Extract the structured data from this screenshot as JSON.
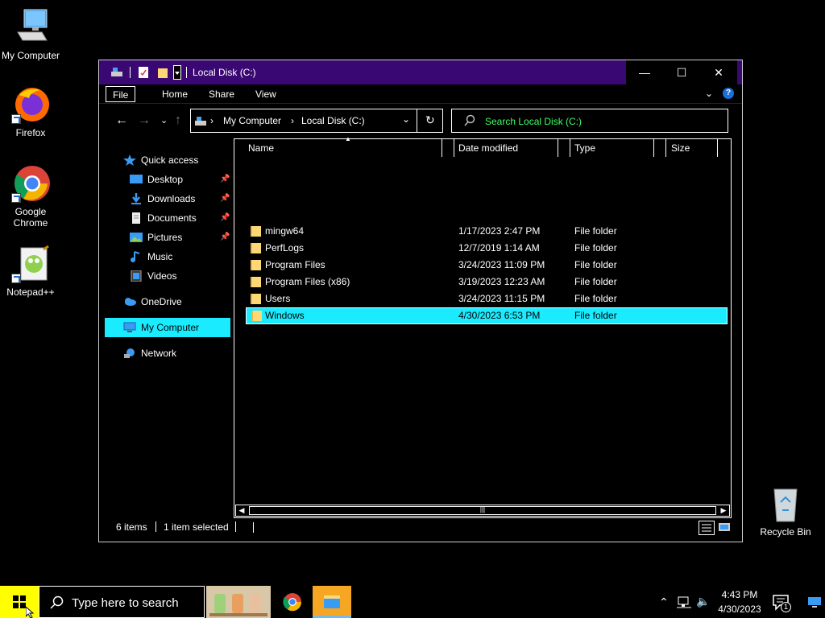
{
  "desktop": {
    "icons": [
      {
        "label": "My Computer"
      },
      {
        "label": "Firefox"
      },
      {
        "label": "Google Chrome"
      },
      {
        "label": "Notepad++"
      },
      {
        "label": "Recycle Bin"
      }
    ]
  },
  "window": {
    "title": "Local Disk (C:)",
    "controls": {
      "minimize": "—",
      "maximize": "☐",
      "close": "✕"
    },
    "ribbon_tabs": [
      "File",
      "Home",
      "Share",
      "View"
    ],
    "address": {
      "segments": [
        "My Computer",
        "Local Disk (C:)"
      ]
    },
    "search": {
      "placeholder": "Search Local Disk (C:)"
    },
    "nav": {
      "quick_access": "Quick access",
      "items": [
        "Desktop",
        "Downloads",
        "Documents",
        "Pictures",
        "Music",
        "Videos"
      ],
      "onedrive": "OneDrive",
      "my_computer": "My Computer",
      "network": "Network"
    },
    "columns": [
      "Name",
      "Date modified",
      "Type",
      "Size"
    ],
    "files": [
      {
        "name": "mingw64",
        "date": "1/17/2023 2:47 PM",
        "type": "File folder"
      },
      {
        "name": "PerfLogs",
        "date": "12/7/2019 1:14 AM",
        "type": "File folder"
      },
      {
        "name": "Program Files",
        "date": "3/24/2023 11:09 PM",
        "type": "File folder"
      },
      {
        "name": "Program Files (x86)",
        "date": "3/19/2023 12:23 AM",
        "type": "File folder"
      },
      {
        "name": "Users",
        "date": "3/24/2023 11:15 PM",
        "type": "File folder"
      },
      {
        "name": "Windows",
        "date": "4/30/2023 6:53 PM",
        "type": "File folder"
      }
    ],
    "status": {
      "count": "6 items",
      "selected": "1 item selected"
    }
  },
  "taskbar": {
    "search_placeholder": "Type here to search",
    "time": "4:43 PM",
    "date": "4/30/2023",
    "notification_count": "1"
  },
  "colors": {
    "accent": "#1aebff",
    "titlebar": "#3a0873",
    "start": "#ffff00",
    "search_text": "#3fff66"
  }
}
